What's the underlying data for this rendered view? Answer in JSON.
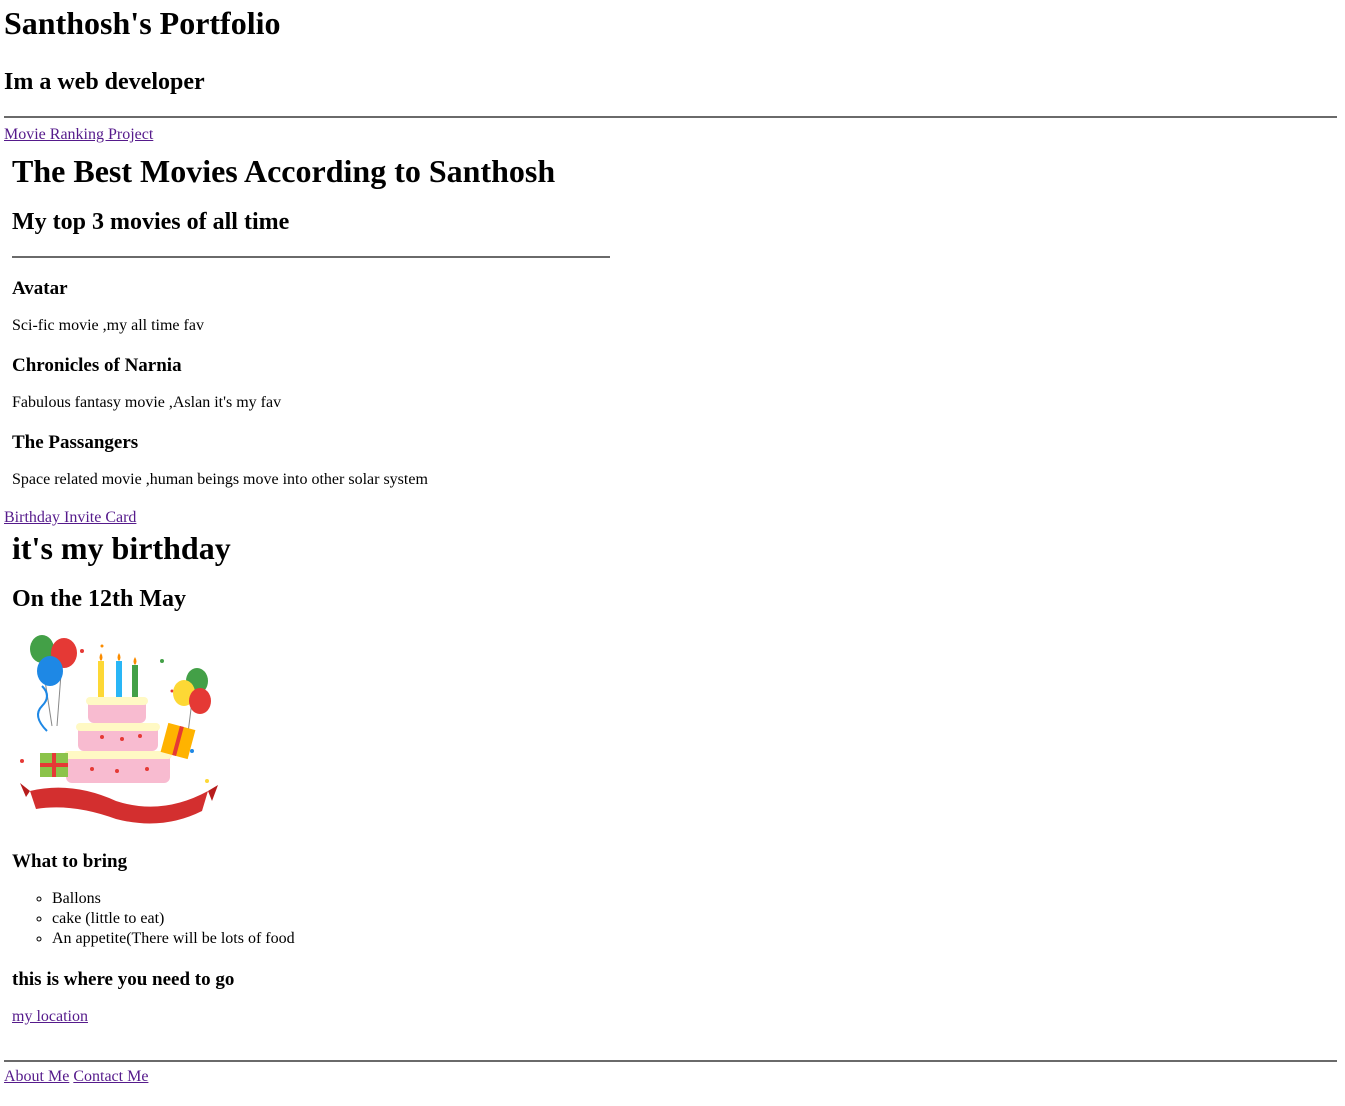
{
  "header": {
    "title": "Santhosh's Portfolio",
    "subtitle": "Im a web developer"
  },
  "links": {
    "movie_project": "Movie Ranking Project",
    "birthday_card": "Birthday Invite Card",
    "my_location": "my location",
    "about_me": "About Me",
    "contact_me": "Contact Me"
  },
  "movies": {
    "title": "The Best Movies According to Santhosh",
    "subtitle": "My top 3 movies of all time",
    "items": [
      {
        "name": "Avatar",
        "desc": "Sci-fic movie ,my all time fav"
      },
      {
        "name": "Chronicles of Narnia",
        "desc": "Fabulous fantasy movie ,Aslan it's my fav"
      },
      {
        "name": "The Passangers",
        "desc": "Space related movie ,human beings move into other solar system"
      }
    ]
  },
  "birthday": {
    "title": "it's my birthday",
    "date": "On the 12th May",
    "bring_heading": "What to bring",
    "bring_items": [
      "Ballons",
      "cake (little to eat)",
      "An appetite(There will be lots of food"
    ],
    "location_heading": "this is where you need to go"
  },
  "colors": {
    "link": "#551a8b",
    "rule": "#6a6a6a"
  }
}
